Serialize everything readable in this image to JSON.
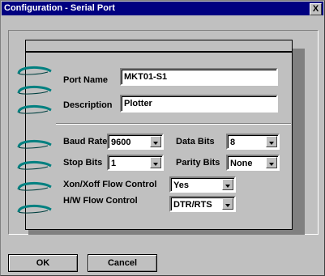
{
  "window": {
    "title": "Configuration - Serial Port",
    "close_label": "X"
  },
  "form": {
    "port_name_label": "Port Name",
    "port_name_value": "MKT01-S1",
    "description_label": "Description",
    "description_value": "Plotter",
    "baud_rate_label": "Baud Rate",
    "baud_rate_value": "9600",
    "data_bits_label": "Data Bits",
    "data_bits_value": "8",
    "stop_bits_label": "Stop Bits",
    "stop_bits_value": "1",
    "parity_bits_label": "Parity Bits",
    "parity_bits_value": "None",
    "xon_label": "Xon/Xoff Flow Control",
    "xon_value": "Yes",
    "hw_label": "H/W Flow Control",
    "hw_value": "DTR/RTS"
  },
  "buttons": {
    "ok": "OK",
    "cancel": "Cancel"
  },
  "colors": {
    "title_bar": "#000080",
    "face": "#c0c0c0",
    "ring": "#008080"
  }
}
